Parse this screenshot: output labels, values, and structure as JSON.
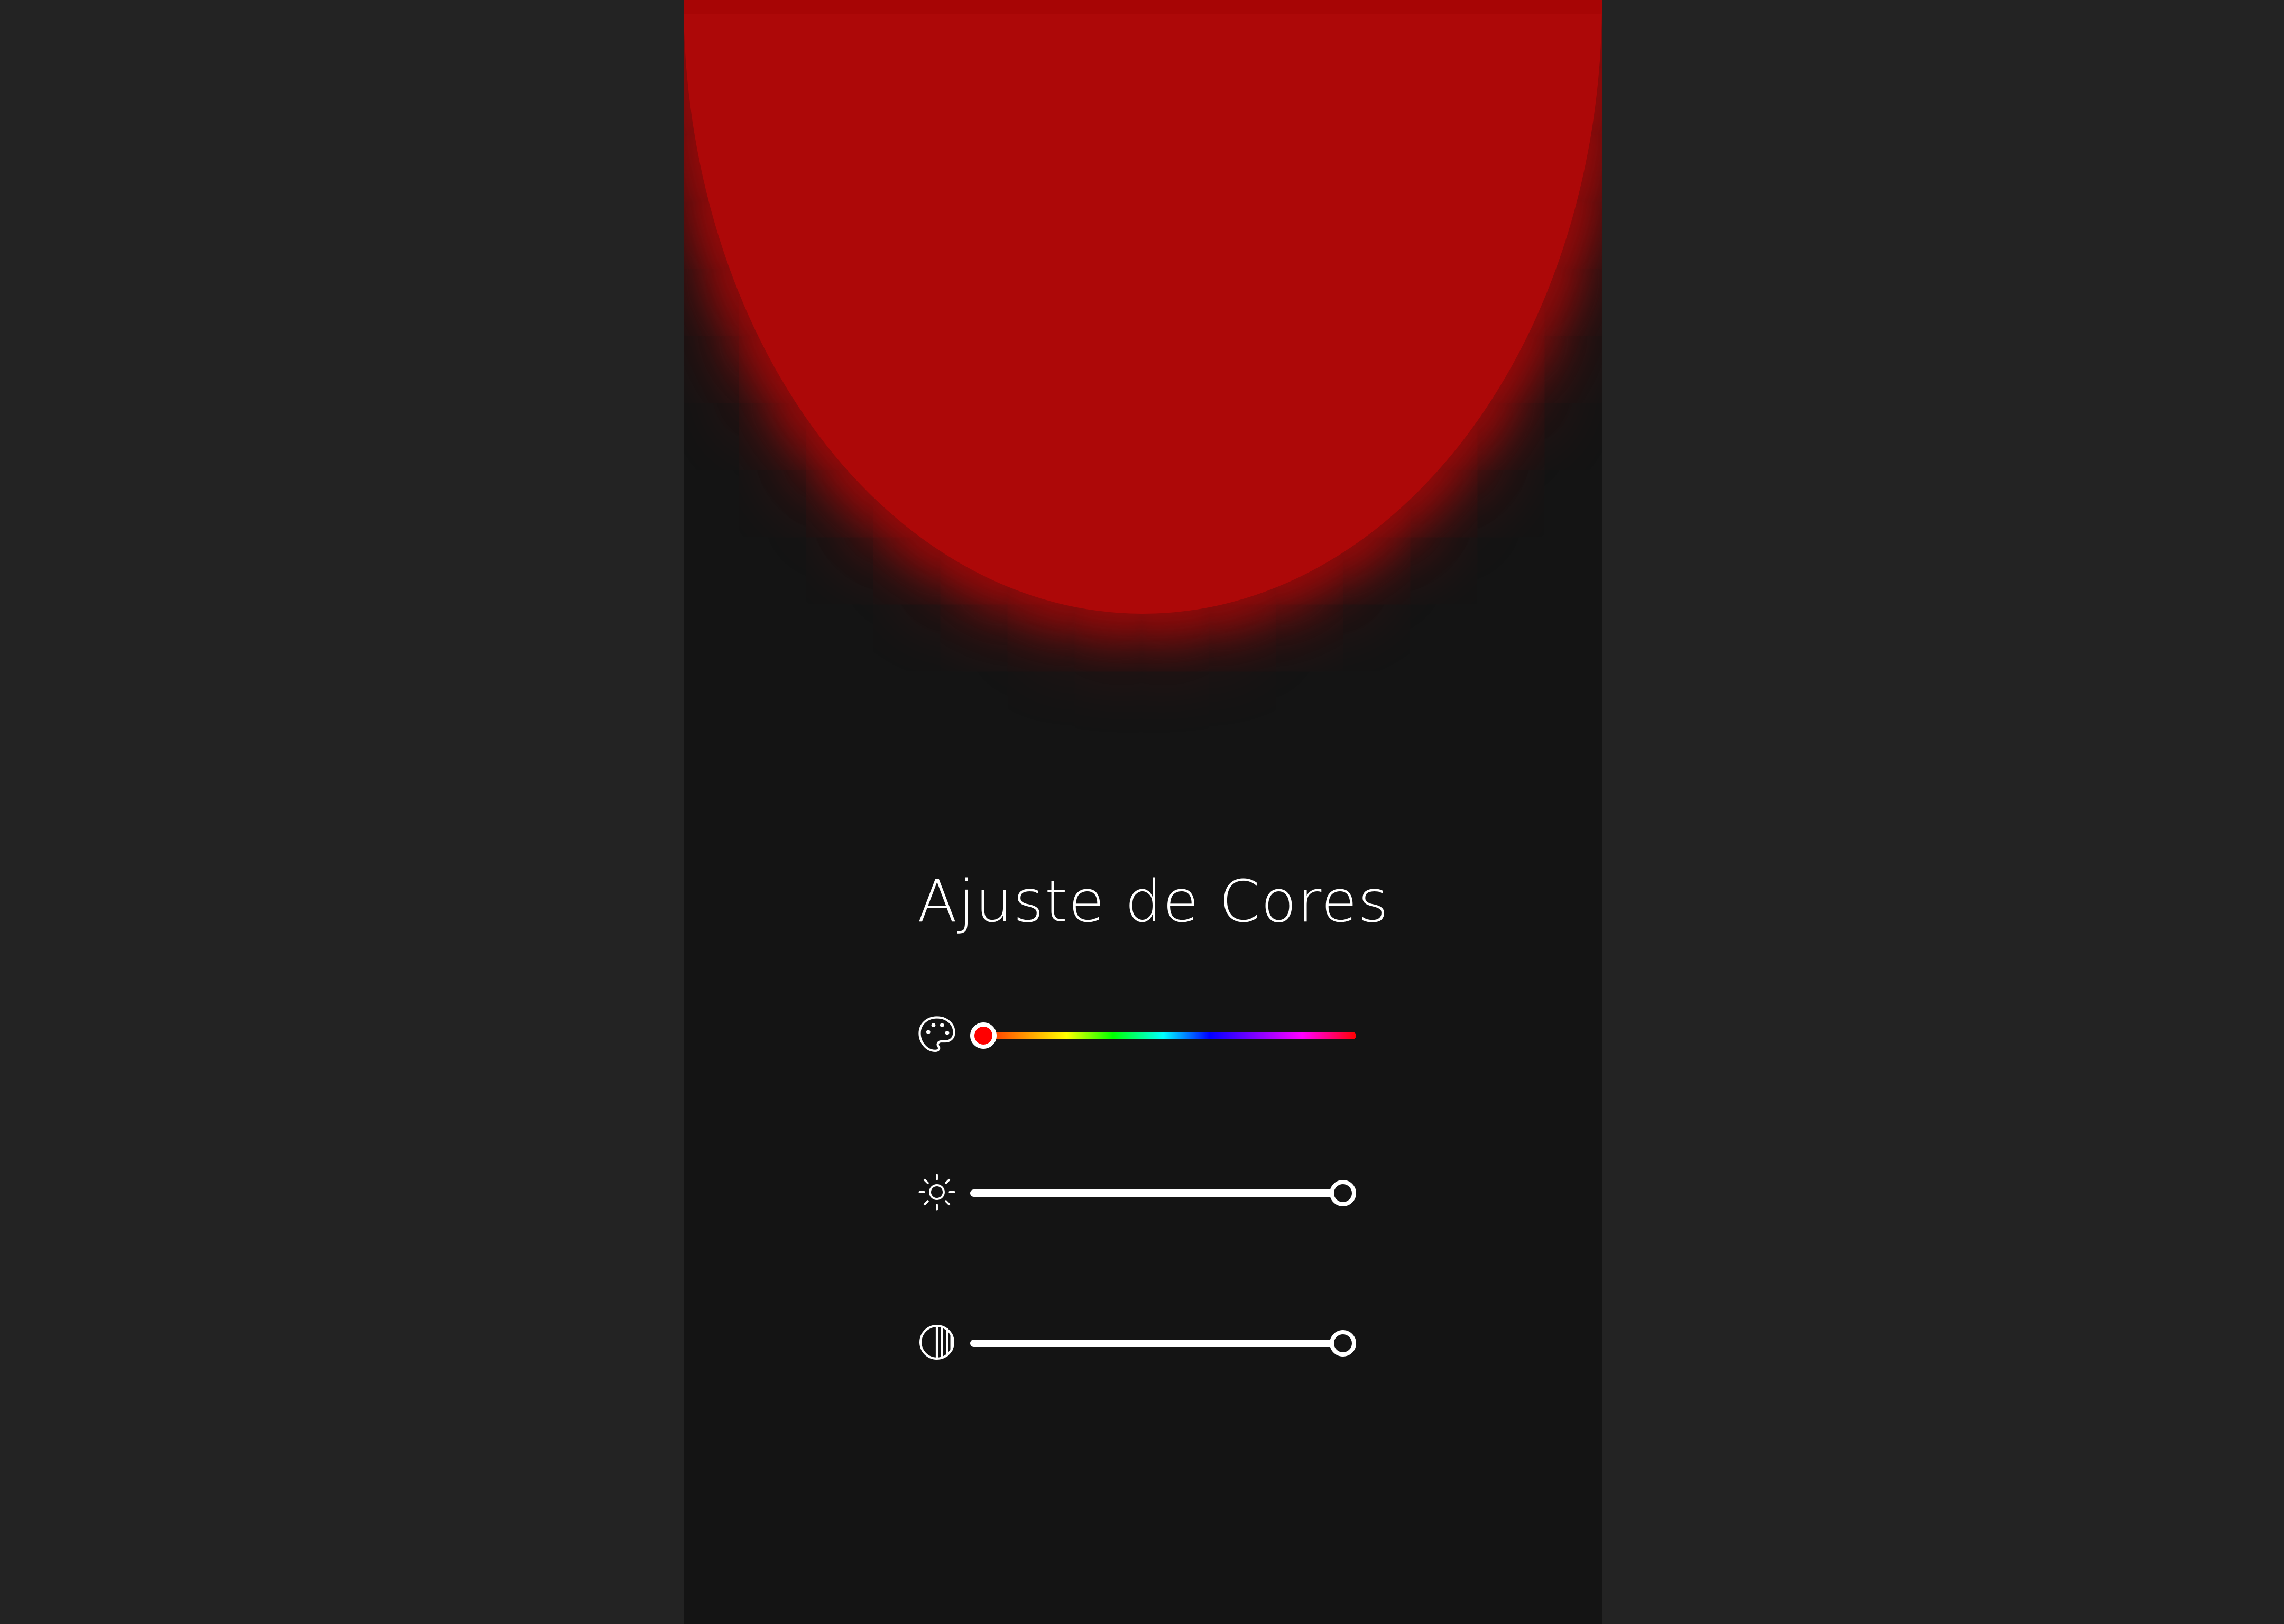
{
  "app": {
    "title": "Ajuste de Cores"
  },
  "preview": {
    "color": "#ad0808",
    "shape": "glowing circle"
  },
  "controls": [
    {
      "name": "hue",
      "icon": "palette-icon",
      "value": 0,
      "track": "rainbow"
    },
    {
      "name": "brightness",
      "icon": "sun-icon",
      "value": 1
    },
    {
      "name": "contrast",
      "icon": "contrast-icon",
      "value": 1
    }
  ],
  "colors": {
    "page_background": "#232323",
    "panel_background": "#141414",
    "text": "#ffffff",
    "accent": "#ad0808"
  }
}
